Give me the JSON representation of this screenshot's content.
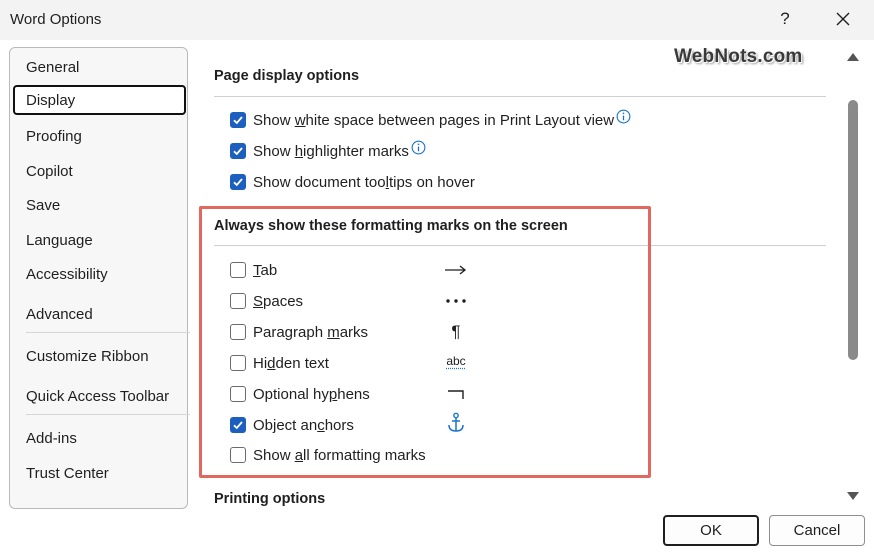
{
  "window": {
    "title": "Word Options",
    "help_label": "?"
  },
  "watermark": "WebNots.com",
  "sidebar": {
    "items": [
      {
        "label": "General"
      },
      {
        "label": "Display",
        "selected": true
      },
      {
        "label": "Proofing"
      },
      {
        "label": "Copilot"
      },
      {
        "label": "Save"
      },
      {
        "label": "Language"
      },
      {
        "label": "Accessibility"
      },
      {
        "label": "Advanced"
      },
      {
        "label": "Customize Ribbon"
      },
      {
        "label": "Quick Access Toolbar"
      },
      {
        "label": "Add-ins"
      },
      {
        "label": "Trust Center"
      }
    ]
  },
  "page_display": {
    "heading": "Page display options",
    "options": [
      {
        "pre": "Show ",
        "key": "w",
        "post": "hite space between pages in Print Layout view",
        "checked": true,
        "info": true
      },
      {
        "pre": "Show ",
        "key": "h",
        "post": "ighlighter marks",
        "checked": true,
        "info": true
      },
      {
        "pre": "Show document too",
        "key": "l",
        "post": "tips on hover",
        "checked": true,
        "info": false
      }
    ]
  },
  "formatting_marks": {
    "heading": "Always show these formatting marks on the screen",
    "options": [
      {
        "pre": "",
        "key": "T",
        "post": "ab",
        "checked": false,
        "mark_icon": "tab-arrow-icon"
      },
      {
        "pre": "",
        "key": "S",
        "post": "paces",
        "checked": false,
        "mark_icon": "spaces-dots-icon"
      },
      {
        "pre": "Paragraph ",
        "key": "m",
        "post": "arks",
        "checked": false,
        "mark_icon": "pilcrow-icon",
        "mark_text": "¶"
      },
      {
        "pre": "Hi",
        "key": "d",
        "post": "den text",
        "checked": false,
        "mark_icon": "hidden-text-icon",
        "mark_text": "abc"
      },
      {
        "pre": "Optional hy",
        "key": "p",
        "post": "hens",
        "checked": false,
        "mark_icon": "optional-hyphen-icon"
      },
      {
        "pre": "Object an",
        "key": "c",
        "post": "hors",
        "checked": true,
        "mark_icon": "anchor-icon"
      },
      {
        "pre": "Show ",
        "key": "a",
        "post": "ll formatting marks",
        "checked": false
      }
    ]
  },
  "printing": {
    "heading": "Printing options"
  },
  "buttons": {
    "ok": "OK",
    "cancel": "Cancel"
  },
  "colors": {
    "checkbox_checked": "#1d5fbf",
    "info_icon": "#1a73c9",
    "anchor_icon": "#1a73c9",
    "highlight_box": "#e0685e"
  }
}
